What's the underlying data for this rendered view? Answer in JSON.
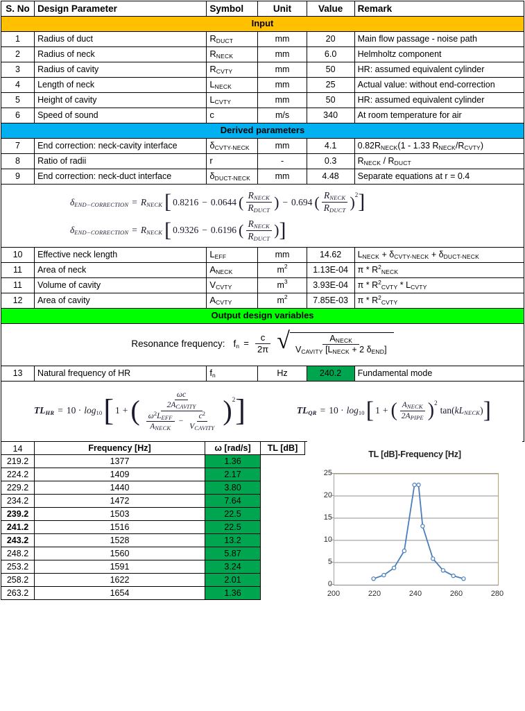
{
  "header": {
    "sno": "S. No",
    "parameter": "Design Parameter",
    "symbol": "Symbol",
    "unit": "Unit",
    "value": "Value",
    "remark": "Remark"
  },
  "bands": {
    "input": "Input",
    "derived": "Derived parameters",
    "output": "Output design variables"
  },
  "colors": {
    "input_band": "#FFC000",
    "derived_band": "#00B0F0",
    "output_band": "#00FF00",
    "highlight_green": "#00A550",
    "chart_line": "#4A7EBB"
  },
  "input_rows": [
    {
      "sno": "1",
      "parameter": "Radius of duct",
      "sym_base": "R",
      "sym_sub": "DUCT",
      "unit": "mm",
      "value": "20",
      "remark": "Main flow passage - noise path"
    },
    {
      "sno": "2",
      "parameter": "Radius of neck",
      "sym_base": "R",
      "sym_sub": "NECK",
      "unit": "mm",
      "value": "6.0",
      "remark": "Helmholtz component"
    },
    {
      "sno": "3",
      "parameter": "Radius of cavity",
      "sym_base": "R",
      "sym_sub": "CVTY",
      "unit": "mm",
      "value": "50",
      "remark": "HR: assumed equivalent cylinder"
    },
    {
      "sno": "4",
      "parameter": "Length of neck",
      "sym_base": "L",
      "sym_sub": "NECK",
      "unit": "mm",
      "value": "25",
      "remark": "Actual value: without end-correction"
    },
    {
      "sno": "5",
      "parameter": "Height of cavity",
      "sym_base": "L",
      "sym_sub": "CVTY",
      "unit": "mm",
      "value": "50",
      "remark": "HR: assumed equivalent cylinder"
    },
    {
      "sno": "6",
      "parameter": "Speed of sound",
      "sym_base": "c",
      "sym_sub": "",
      "unit": "m/s",
      "value": "340",
      "remark": "At room temperature for air"
    }
  ],
  "derived_rows": [
    {
      "sno": "7",
      "parameter": "End correction: neck-cavity interface",
      "sym_base": "δ",
      "sym_sub": "CVTY-NECK",
      "unit": "mm",
      "value": "4.1",
      "remark_html": "0.82R<sub>NECK</sub>(1 - 1.33 R<sub>NECK</sub>/R<sub>CVTY</sub>)"
    },
    {
      "sno": "8",
      "parameter": "Ratio of radii",
      "sym_base": "r",
      "sym_sub": "",
      "unit": "-",
      "value": "0.3",
      "remark_html": "R<sub>NECK</sub> / R<sub>DUCT</sub>"
    },
    {
      "sno": "9",
      "parameter": "End correction: neck-duct interface",
      "sym_base": "δ",
      "sym_sub": "DUCT-NECK",
      "unit": "mm",
      "value": "4.48",
      "remark_html": "Separate equations at r = 0.4"
    }
  ],
  "derived2_rows": [
    {
      "sno": "10",
      "parameter": "Effective neck length",
      "sym_base": "L",
      "sym_sub": "EFF",
      "unit_html": "mm",
      "value": "14.62",
      "remark_html": "L<sub>NECK</sub> + δ<sub>CVTY-NECK</sub> + δ<sub>DUCT-NECK</sub>"
    },
    {
      "sno": "11",
      "parameter": "Area of neck",
      "sym_base": "A",
      "sym_sub": "NECK",
      "unit_html": "m<sup>2</sup>",
      "value": "1.13E-04",
      "remark_html": "π * R<sup>2</sup><sub>NECK</sub>"
    },
    {
      "sno": "11",
      "parameter": "Volume of cavity",
      "sym_base": "V",
      "sym_sub": "CVTY",
      "unit_html": "m<sup>3</sup>",
      "value": "3.93E-04",
      "remark_html": "π * R<sup>2</sup><sub>CVTY</sub> * L<sub>CVTY</sub>"
    },
    {
      "sno": "12",
      "parameter": "Area of cavity",
      "sym_base": "A",
      "sym_sub": "CVTY",
      "unit_html": "m<sup>2</sup>",
      "value": "7.85E-03",
      "remark_html": "π * R<sup>2</sup><sub>CVTY</sub>"
    }
  ],
  "output_row": {
    "sno": "13",
    "parameter": "Natural frequency of HR",
    "sym_base": "f",
    "sym_sub": "n",
    "unit": "Hz",
    "value": "240.2",
    "remark": "Fundamental mode"
  },
  "formulas": {
    "end_correction_1": "δ_END-CORRECTION = R_NECK [ 0.8216 − 0.0644 (R_NECK/R_DUCT) − 0.694 (R_NECK/R_DUCT)^2 ]",
    "end_correction_2": "δ_END-CORRECTION = R_NECK [ 0.9326 − 0.6196 (R_NECK/R_DUCT) ]",
    "resonance_label": "Resonance frequency:",
    "resonance": "f_n = (c / 2π) √( A_NECK / (V_CAVITY [L_NECK + 2 δ_END]) )",
    "tl_hr": "TL_HR = 10 · log10 [ 1 + ( (ωc / 2A_CAVITY) / (ω²L_EFF/A_NECK − c²/V_CAVITY) )² ]",
    "tl_qr": "TL_QR = 10 · log10 [ 1 + (A_NECK / 2A_PIPE)² tan(kL_NECK) ]",
    "parts": {
      "delta_sub": "END−CORRECTION",
      "c1": "0.8216",
      "c2": "0.0644",
      "c3": "0.694",
      "d1": "0.9326",
      "d2": "0.6196",
      "ten": "10",
      "log": "log",
      "log_sub": "10",
      "one": "1",
      "two": "2"
    }
  },
  "bottom_table": {
    "sno": "14",
    "headers": {
      "freq": "Frequency [Hz]",
      "omega": "ω [rad/s]",
      "tl": "TL [dB]"
    },
    "rows": [
      {
        "freq": "219.2",
        "omega": "1377",
        "tl": "1.36",
        "bold": false
      },
      {
        "freq": "224.2",
        "omega": "1409",
        "tl": "2.17",
        "bold": false
      },
      {
        "freq": "229.2",
        "omega": "1440",
        "tl": "3.80",
        "bold": false
      },
      {
        "freq": "234.2",
        "omega": "1472",
        "tl": "7.64",
        "bold": false
      },
      {
        "freq": "239.2",
        "omega": "1503",
        "tl": "22.5",
        "bold": true
      },
      {
        "freq": "241.2",
        "omega": "1516",
        "tl": "22.5",
        "bold": true
      },
      {
        "freq": "243.2",
        "omega": "1528",
        "tl": "13.2",
        "bold": true
      },
      {
        "freq": "248.2",
        "omega": "1560",
        "tl": "5.87",
        "bold": false
      },
      {
        "freq": "253.2",
        "omega": "1591",
        "tl": "3.24",
        "bold": false
      },
      {
        "freq": "258.2",
        "omega": "1622",
        "tl": "2.01",
        "bold": false
      },
      {
        "freq": "263.2",
        "omega": "1654",
        "tl": "1.36",
        "bold": false
      }
    ]
  },
  "chart_data": {
    "type": "line",
    "title": "TL [dB]-Frequency [Hz]",
    "xlabel": "",
    "ylabel": "",
    "x": [
      219.2,
      224.2,
      229.2,
      234.2,
      239.2,
      241.2,
      243.2,
      248.2,
      253.2,
      258.2,
      263.2
    ],
    "values": [
      1.36,
      2.17,
      3.8,
      7.64,
      22.5,
      22.5,
      13.2,
      5.87,
      3.24,
      2.01,
      1.36
    ],
    "series": [
      {
        "name": "TL [dB]",
        "values": [
          1.36,
          2.17,
          3.8,
          7.64,
          22.5,
          22.5,
          13.2,
          5.87,
          3.24,
          2.01,
          1.36
        ]
      }
    ],
    "xlim": [
      200,
      280
    ],
    "ylim": [
      0,
      25
    ],
    "xticks": [
      200,
      220,
      240,
      260,
      280
    ],
    "yticks": [
      0,
      5,
      10,
      15,
      20,
      25
    ],
    "grid": "horizontal",
    "legend": "none",
    "markers": "open-circle",
    "line_color": "#4A7EBB"
  }
}
